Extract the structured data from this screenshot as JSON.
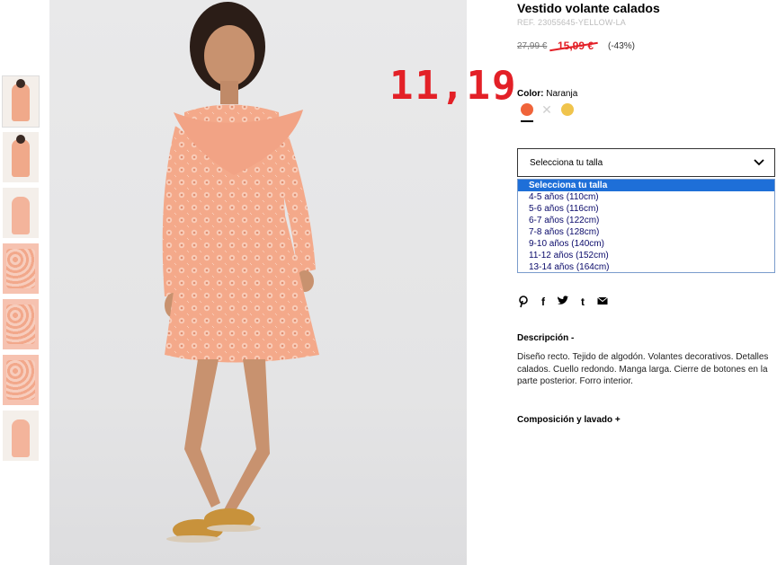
{
  "product": {
    "title": "Vestido volante calados",
    "ref": "REF. 23055645-YELLOW-LA",
    "old_price": "27,99 €",
    "sale_price": "15,99 €",
    "discount": "(-43%)",
    "annotated_price": "11,19"
  },
  "color": {
    "label": "Color:",
    "value": "Naranja",
    "swatches": [
      {
        "name": "Naranja",
        "hex": "#f0643a"
      },
      {
        "name": "unavailable",
        "glyph": "✕"
      },
      {
        "name": "Amarillo",
        "hex": "#f0c44c"
      }
    ]
  },
  "size": {
    "placeholder": "Selecciona tu talla",
    "options": [
      "Selecciona tu talla",
      "4-5 años (110cm)",
      "5-6 años (116cm)",
      "6-7 años (122cm)",
      "7-8 años (128cm)",
      "9-10 años (140cm)",
      "11-12 años (152cm)",
      "13-14 años (164cm)"
    ],
    "selected_index": 0
  },
  "share_icons": [
    "pinterest-icon",
    "facebook-icon",
    "twitter-icon",
    "tumblr-icon",
    "email-icon"
  ],
  "share_glyphs": [
    "℗",
    "f",
    "🐦",
    "t",
    "✉"
  ],
  "description": {
    "heading": "Descripción -",
    "text": "Diseño recto. Tejido de algodón. Volantes decorativos. Detalles calados. Cuello redondo. Manga larga. Cierre de botones en la parte posterior. Forro interior."
  },
  "composition": {
    "heading": "Composición y lavado +"
  }
}
